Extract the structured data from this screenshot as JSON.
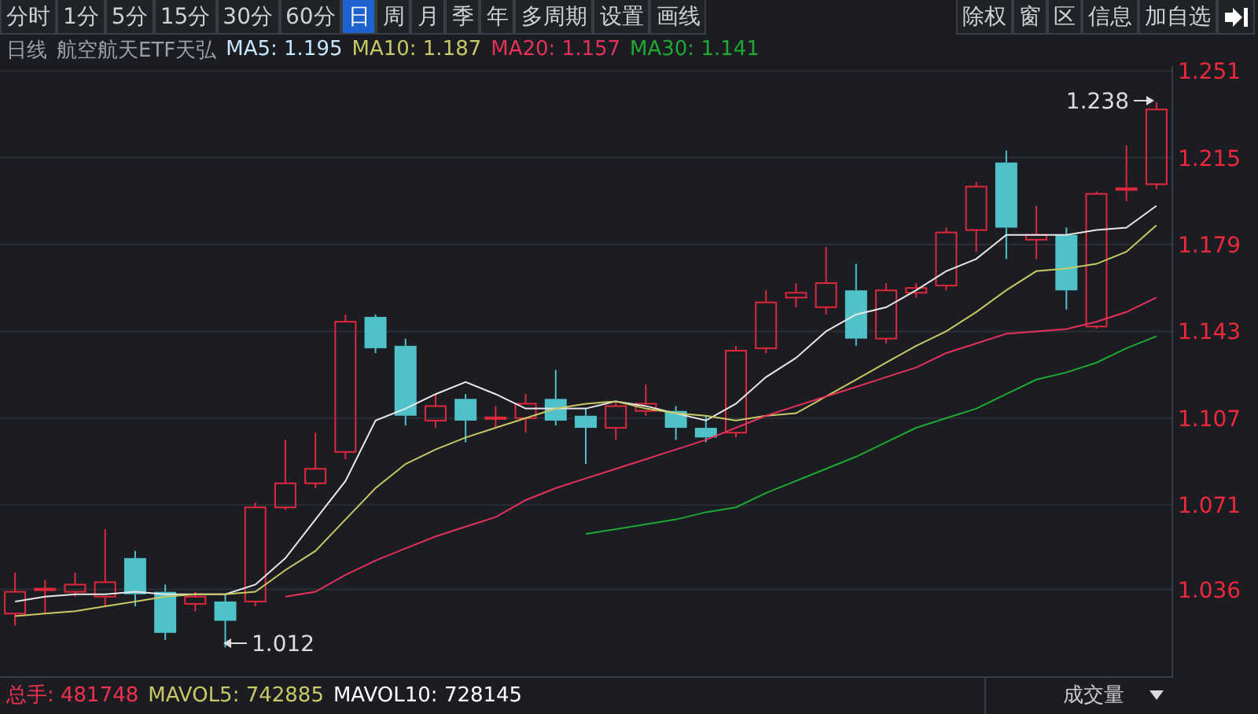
{
  "toolbar": {
    "tabs": [
      {
        "label": "分时",
        "selected": false
      },
      {
        "label": "1分",
        "selected": false
      },
      {
        "label": "5分",
        "selected": false
      },
      {
        "label": "15分",
        "selected": false
      },
      {
        "label": "30分",
        "selected": false
      },
      {
        "label": "60分",
        "selected": false
      },
      {
        "label": "日",
        "selected": true
      },
      {
        "label": "周",
        "selected": false
      },
      {
        "label": "月",
        "selected": false
      },
      {
        "label": "季",
        "selected": false
      },
      {
        "label": "年",
        "selected": false
      },
      {
        "label": "多周期",
        "selected": false
      },
      {
        "label": "设置",
        "selected": false
      },
      {
        "label": "画线",
        "selected": false
      }
    ],
    "actions": [
      "除权",
      "窗",
      "区",
      "信息",
      "加自选"
    ]
  },
  "info_line": {
    "period": "日线",
    "name": "航空航天ETF天弘",
    "indicators": [
      {
        "text": "MA5: 1.195",
        "color": "#c8e6ff"
      },
      {
        "text": "MA10: 1.187",
        "color": "#c8c864"
      },
      {
        "text": "MA20: 1.157",
        "color": "#e6325a"
      },
      {
        "text": "MA30: 1.141",
        "color": "#1eaa32"
      }
    ]
  },
  "chart": {
    "chart_data": {
      "type": "candlestick",
      "grid": true,
      "ylim": [
        1.0,
        1.253
      ],
      "yticks": [
        {
          "value": 1.251,
          "label": "1.251"
        },
        {
          "value": 1.215,
          "label": "1.215"
        },
        {
          "value": 1.179,
          "label": "1.179"
        },
        {
          "value": 1.143,
          "label": "1.143"
        },
        {
          "value": 1.107,
          "label": "1.107"
        },
        {
          "value": 1.071,
          "label": "1.071"
        },
        {
          "value": 1.036,
          "label": "1.036"
        }
      ],
      "categories": [
        null,
        null,
        null,
        null,
        null,
        null,
        null,
        null,
        null,
        null,
        null,
        null,
        null,
        null,
        null,
        null,
        null,
        null,
        null,
        null,
        null,
        null,
        null,
        null,
        null,
        null,
        null,
        null,
        null,
        null,
        null,
        null,
        null,
        null,
        null,
        null,
        null,
        null,
        null
      ],
      "ohlc": [
        [
          1.026,
          1.043,
          1.021,
          1.035
        ],
        [
          1.036,
          1.04,
          1.026,
          1.036
        ],
        [
          1.035,
          1.043,
          1.033,
          1.038
        ],
        [
          1.033,
          1.061,
          1.029,
          1.039
        ],
        [
          1.049,
          1.052,
          1.029,
          1.034
        ],
        [
          1.035,
          1.038,
          1.015,
          1.018
        ],
        [
          1.03,
          1.035,
          1.027,
          1.033
        ],
        [
          1.031,
          1.034,
          1.012,
          1.023
        ],
        [
          1.031,
          1.072,
          1.029,
          1.07
        ],
        [
          1.07,
          1.098,
          1.069,
          1.08
        ],
        [
          1.08,
          1.101,
          1.078,
          1.086
        ],
        [
          1.093,
          1.15,
          1.09,
          1.147
        ],
        [
          1.149,
          1.15,
          1.134,
          1.136
        ],
        [
          1.137,
          1.14,
          1.104,
          1.108
        ],
        [
          1.106,
          1.117,
          1.103,
          1.112
        ],
        [
          1.115,
          1.117,
          1.097,
          1.106
        ],
        [
          1.107,
          1.112,
          1.103,
          1.107
        ],
        [
          1.107,
          1.117,
          1.101,
          1.113
        ],
        [
          1.115,
          1.127,
          1.104,
          1.106
        ],
        [
          1.108,
          1.111,
          1.088,
          1.103
        ],
        [
          1.103,
          1.114,
          1.098,
          1.112
        ],
        [
          1.11,
          1.121,
          1.108,
          1.113
        ],
        [
          1.11,
          1.112,
          1.098,
          1.103
        ],
        [
          1.103,
          1.108,
          1.097,
          1.099
        ],
        [
          1.101,
          1.137,
          1.099,
          1.135
        ],
        [
          1.136,
          1.16,
          1.134,
          1.155
        ],
        [
          1.157,
          1.163,
          1.153,
          1.159
        ],
        [
          1.153,
          1.178,
          1.15,
          1.163
        ],
        [
          1.16,
          1.171,
          1.137,
          1.14
        ],
        [
          1.14,
          1.163,
          1.138,
          1.16
        ],
        [
          1.159,
          1.163,
          1.157,
          1.161
        ],
        [
          1.162,
          1.186,
          1.16,
          1.184
        ],
        [
          1.185,
          1.205,
          1.176,
          1.203
        ],
        [
          1.213,
          1.218,
          1.173,
          1.186
        ],
        [
          1.181,
          1.195,
          1.173,
          1.183
        ],
        [
          1.183,
          1.186,
          1.152,
          1.16
        ],
        [
          1.145,
          1.201,
          1.144,
          1.2
        ],
        [
          1.202,
          1.22,
          1.197,
          1.202
        ],
        [
          1.204,
          1.238,
          1.202,
          1.235
        ]
      ],
      "series": [
        {
          "type": "line",
          "color": "#e8e8e8",
          "values": [
            1.031,
            1.033,
            1.034,
            1.034,
            1.035,
            1.034,
            1.034,
            1.034,
            1.038,
            1.049,
            1.065,
            1.081,
            1.106,
            1.111,
            1.117,
            1.122,
            1.117,
            1.111,
            1.111,
            1.111,
            1.114,
            1.112,
            1.109,
            1.106,
            1.113,
            1.124,
            1.132,
            1.143,
            1.15,
            1.153,
            1.16,
            1.168,
            1.173,
            1.183,
            1.183,
            1.183,
            1.185,
            1.186,
            1.195
          ]
        },
        {
          "type": "line",
          "color": "#c8c864",
          "values": [
            1.025,
            1.026,
            1.027,
            1.029,
            1.031,
            1.033,
            1.034,
            1.034,
            1.035,
            1.044,
            1.052,
            1.065,
            1.078,
            1.088,
            1.094,
            1.099,
            1.103,
            1.107,
            1.111,
            1.113,
            1.114,
            1.111,
            1.109,
            1.108,
            1.106,
            1.108,
            1.109,
            1.116,
            1.123,
            1.13,
            1.137,
            1.143,
            1.151,
            1.16,
            1.168,
            1.169,
            1.171,
            1.176,
            1.187
          ]
        },
        {
          "type": "line",
          "color": "#e6325a",
          "values": [
            null,
            null,
            null,
            null,
            null,
            null,
            null,
            null,
            null,
            1.033,
            1.035,
            1.042,
            1.048,
            1.053,
            1.058,
            1.062,
            1.066,
            1.073,
            1.078,
            1.082,
            1.086,
            1.09,
            1.094,
            1.098,
            1.103,
            1.108,
            1.112,
            1.116,
            1.12,
            1.124,
            1.128,
            1.134,
            1.138,
            1.142,
            1.143,
            1.144,
            1.147,
            1.151,
            1.157
          ]
        },
        {
          "type": "line",
          "color": "#1eaa32",
          "values": [
            null,
            null,
            null,
            null,
            null,
            null,
            null,
            null,
            null,
            null,
            null,
            null,
            null,
            null,
            null,
            null,
            null,
            null,
            null,
            1.059,
            1.061,
            1.063,
            1.065,
            1.068,
            1.07,
            1.076,
            1.081,
            1.086,
            1.091,
            1.097,
            1.103,
            1.107,
            1.111,
            1.117,
            1.123,
            1.126,
            1.13,
            1.136,
            1.141
          ]
        }
      ]
    }
  },
  "markers": {
    "high": "1.238",
    "low": "1.012"
  },
  "volume_bar": {
    "items": [
      {
        "text": "总手: 481748",
        "color": "#f0324b"
      },
      {
        "text": "MAVOL5: 742885",
        "color": "#c8c864"
      },
      {
        "text": "MAVOL10: 728145",
        "color": "#ffffff"
      }
    ],
    "dropdown": "成交量"
  }
}
